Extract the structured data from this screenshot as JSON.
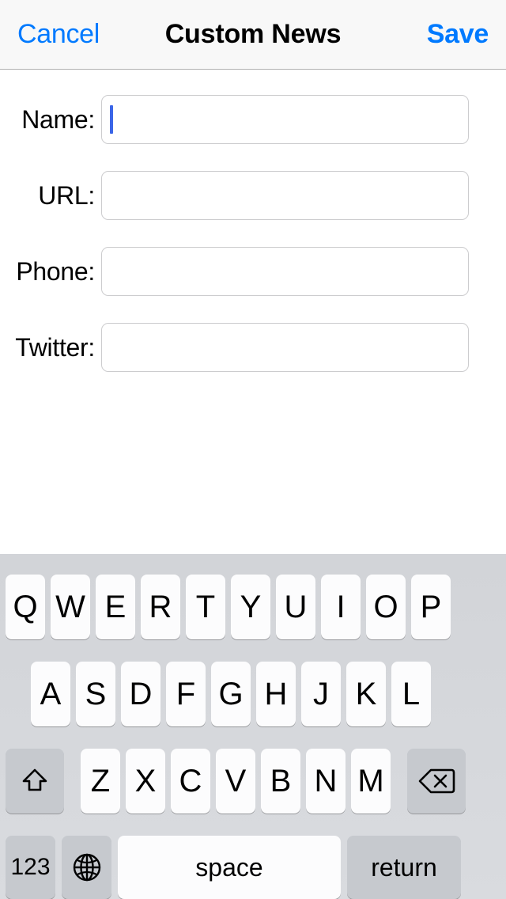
{
  "navbar": {
    "cancel_label": "Cancel",
    "title": "Custom News",
    "save_label": "Save",
    "accent_color": "#007aff"
  },
  "form": {
    "fields": [
      {
        "label": "Name:",
        "value": "",
        "placeholder": "",
        "focused": true
      },
      {
        "label": "URL:",
        "value": "",
        "placeholder": "",
        "focused": false
      },
      {
        "label": "Phone:",
        "value": "",
        "placeholder": "",
        "focused": false
      },
      {
        "label": "Twitter:",
        "value": "",
        "placeholder": "",
        "focused": false
      }
    ]
  },
  "keyboard": {
    "layout": "qwerty-uppercase",
    "row1": [
      "Q",
      "W",
      "E",
      "R",
      "T",
      "Y",
      "U",
      "I",
      "O",
      "P"
    ],
    "row2": [
      "A",
      "S",
      "D",
      "F",
      "G",
      "H",
      "J",
      "K",
      "L"
    ],
    "row3": [
      "Z",
      "X",
      "C",
      "V",
      "B",
      "N",
      "M"
    ],
    "shift_icon": "shift-arrow-icon",
    "delete_icon": "backspace-delete-icon",
    "numbers_label": "123",
    "globe_icon": "globe-language-icon",
    "space_label": "space",
    "return_label": "return"
  }
}
